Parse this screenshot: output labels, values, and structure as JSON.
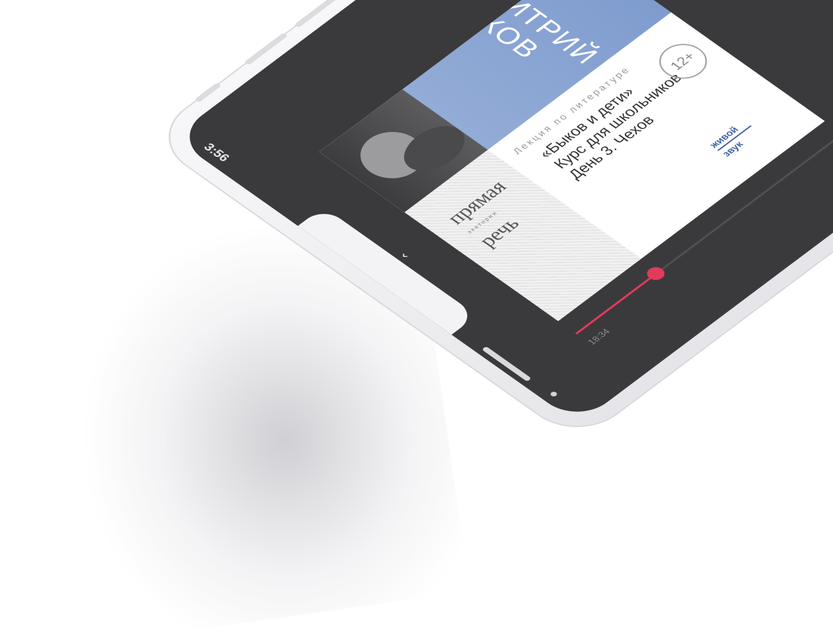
{
  "status_bar": {
    "time": "3:56"
  },
  "header": {
    "collapse_icon": "chevron-down-icon"
  },
  "cover": {
    "author_lines": [
      "ДМИТРИЙ",
      "БЫКОВ"
    ],
    "subtitle": "Лекция по литературе",
    "title_lines": [
      "«Быков и дети»",
      "Курс для школьников",
      "День 3. Чехов"
    ],
    "age_rating": "12+",
    "publisher_logo": [
      "прямая",
      "речь"
    ],
    "publisher_sub": "лектории",
    "live_sound": [
      "живой",
      "звук"
    ]
  },
  "player": {
    "elapsed": "18:34",
    "progress_fraction": 0.24,
    "prev_icon": "skip-back-icon",
    "play_icon": "play-icon"
  },
  "colors": {
    "accent": "#e32d55",
    "cover_blue": "#8aa5d3",
    "screen_bg": "#3a3a3c"
  }
}
